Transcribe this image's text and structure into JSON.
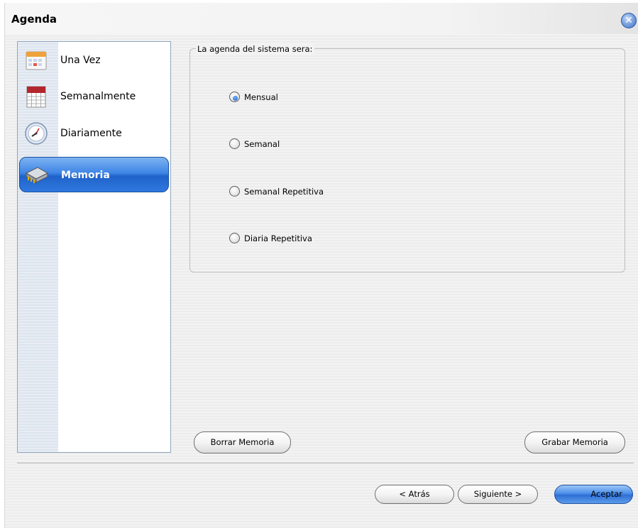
{
  "window": {
    "title": "Agenda"
  },
  "nav": {
    "items": [
      {
        "label": "Una Vez",
        "icon": "calendar-icon"
      },
      {
        "label": "Semanalmente",
        "icon": "weekly-calendar-icon"
      },
      {
        "label": "Diariamente",
        "icon": "clock-icon"
      },
      {
        "label": "Memoria",
        "icon": "memory-chip-icon",
        "selected": true
      }
    ]
  },
  "schedule": {
    "group_label": "La agenda del sistema sera:",
    "options": [
      {
        "label": "Mensual",
        "checked": true
      },
      {
        "label": "Semanal",
        "checked": false
      },
      {
        "label": "Semanal Repetitiva",
        "checked": false
      },
      {
        "label": "Diaria Repetitiva",
        "checked": false
      }
    ]
  },
  "memory_buttons": {
    "clear_label": "Borrar Memoria",
    "save_label": "Grabar Memoria"
  },
  "footer": {
    "back_label": "< Atrás",
    "next_label": "Siguiente >",
    "accept_label": "Aceptar"
  },
  "colors": {
    "selection_blue": "#2f79e0",
    "radio_dot": "#1f5fd0"
  }
}
